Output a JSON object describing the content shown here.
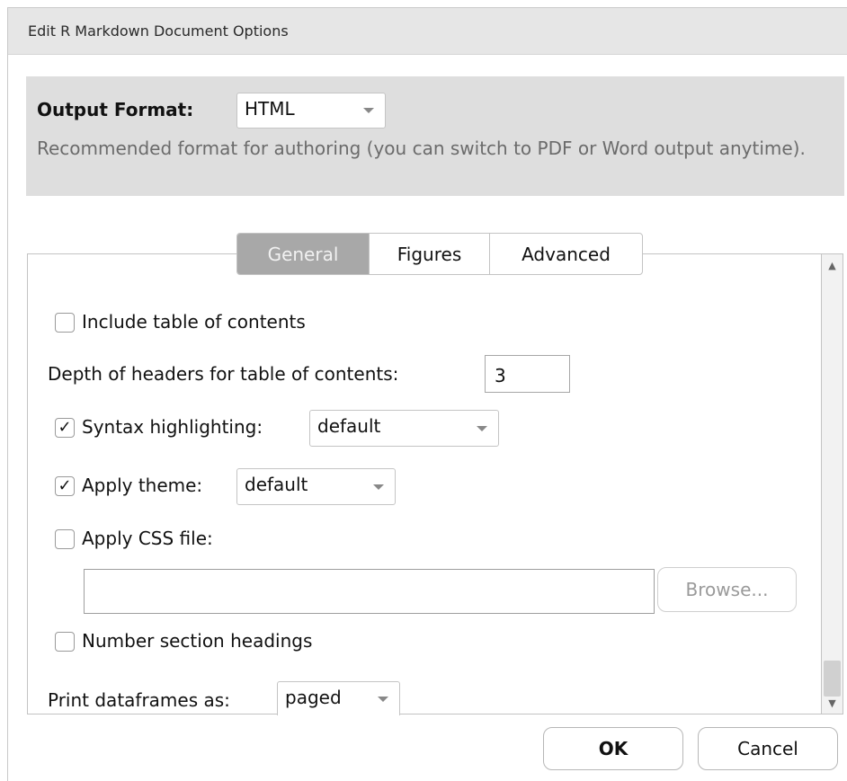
{
  "window": {
    "title": "Edit R Markdown Document Options"
  },
  "output_format": {
    "label": "Output Format:",
    "selected": "HTML",
    "help": "Recommended format for authoring (you can switch to PDF or Word output anytime)."
  },
  "tabs": [
    {
      "label": "General",
      "active": true
    },
    {
      "label": "Figures",
      "active": false
    },
    {
      "label": "Advanced",
      "active": false
    }
  ],
  "general": {
    "toc": {
      "label": "Include table of contents",
      "checked": false
    },
    "toc_depth": {
      "label": "Depth of headers for table of contents:",
      "value": "3"
    },
    "syntax": {
      "label": "Syntax highlighting:",
      "checked": true,
      "selected": "default"
    },
    "theme": {
      "label": "Apply theme:",
      "checked": true,
      "selected": "default"
    },
    "css": {
      "label": "Apply CSS file:",
      "checked": false,
      "value": "",
      "browse_label": "Browse..."
    },
    "number_sections": {
      "label": "Number section headings",
      "checked": false
    },
    "df_print": {
      "label": "Print dataframes as:",
      "selected": "paged"
    }
  },
  "buttons": {
    "ok": "OK",
    "cancel": "Cancel"
  },
  "icons": {
    "check": "✓",
    "scroll_up": "▲",
    "scroll_down": "▼"
  }
}
